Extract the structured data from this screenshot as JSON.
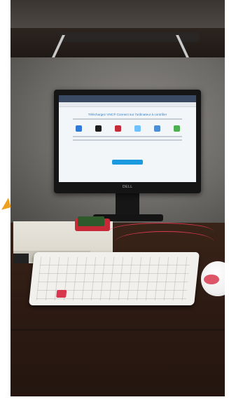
{
  "scene": {
    "monitor_brand": "DELL",
    "screen_heading": "Téléchargez VNC® Connect sur l'ordinateur à contrôler",
    "os_icon_colors": [
      "#2f7ad8",
      "#1d1d1d",
      "#c52a36",
      "#6ec0ff",
      "#4a8fd6",
      "#4caf50"
    ],
    "pi_case_color": "#c52a36",
    "cable_color": "#d83a4f",
    "keyboard_color": "#f2f0ec",
    "mouse_color": "#ffffff",
    "arrow_color": "#f0a020"
  }
}
